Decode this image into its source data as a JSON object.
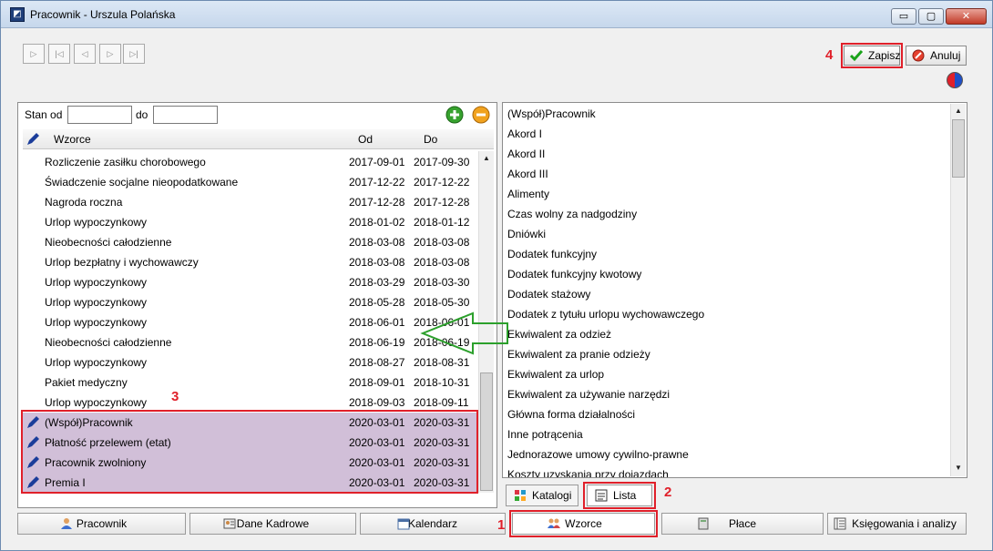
{
  "window": {
    "title": "Pracownik - Urszula Polańska",
    "min_glyph": "▭",
    "max_glyph": "▢",
    "close_glyph": "✕"
  },
  "nav_buttons": [
    "▷",
    "|◁",
    "◁",
    "▷",
    "▷|"
  ],
  "toolbar": {
    "save_label": "Zapisz",
    "cancel_label": "Anuluj"
  },
  "filter": {
    "from_label": "Stan od",
    "to_label": "do",
    "from_value": "",
    "to_value": ""
  },
  "grid": {
    "columns": [
      "Wzorce",
      "Od",
      "Do"
    ],
    "rows": [
      {
        "name": "Rozliczenie zasiłku chorobowego",
        "od": "2017-09-01",
        "do": "2017-09-30",
        "selected": false
      },
      {
        "name": "Świadczenie socjalne nieopodatkowane",
        "od": "2017-12-22",
        "do": "2017-12-22",
        "selected": false
      },
      {
        "name": "Nagroda roczna",
        "od": "2017-12-28",
        "do": "2017-12-28",
        "selected": false
      },
      {
        "name": "Urlop wypoczynkowy",
        "od": "2018-01-02",
        "do": "2018-01-12",
        "selected": false
      },
      {
        "name": "Nieobecności całodzienne",
        "od": "2018-03-08",
        "do": "2018-03-08",
        "selected": false
      },
      {
        "name": "Urlop bezpłatny i wychowawczy",
        "od": "2018-03-08",
        "do": "2018-03-08",
        "selected": false
      },
      {
        "name": "Urlop wypoczynkowy",
        "od": "2018-03-29",
        "do": "2018-03-30",
        "selected": false
      },
      {
        "name": "Urlop wypoczynkowy",
        "od": "2018-05-28",
        "do": "2018-05-30",
        "selected": false
      },
      {
        "name": "Urlop wypoczynkowy",
        "od": "2018-06-01",
        "do": "2018-06-01",
        "selected": false
      },
      {
        "name": "Nieobecności całodzienne",
        "od": "2018-06-19",
        "do": "2018-06-19",
        "selected": false
      },
      {
        "name": "Urlop wypoczynkowy",
        "od": "2018-08-27",
        "do": "2018-08-31",
        "selected": false
      },
      {
        "name": "Pakiet medyczny",
        "od": "2018-09-01",
        "do": "2018-10-31",
        "selected": false
      },
      {
        "name": "Urlop wypoczynkowy",
        "od": "2018-09-03",
        "do": "2018-09-11",
        "selected": false
      },
      {
        "name": "(Współ)Pracownik",
        "od": "2020-03-01",
        "do": "2020-03-31",
        "selected": true
      },
      {
        "name": "Płatność przelewem (etat)",
        "od": "2020-03-01",
        "do": "2020-03-31",
        "selected": true
      },
      {
        "name": "Pracownik zwolniony",
        "od": "2020-03-01",
        "do": "2020-03-31",
        "selected": true
      },
      {
        "name": "Premia I",
        "od": "2020-03-01",
        "do": "2020-03-31",
        "selected": true
      }
    ]
  },
  "list": {
    "items": [
      "(Współ)Pracownik",
      "Akord I",
      "Akord II",
      "Akord III",
      "Alimenty",
      "Czas wolny za nadgodziny",
      "Dniówki",
      "Dodatek funkcyjny",
      "Dodatek funkcyjny kwotowy",
      "Dodatek stażowy",
      "Dodatek z tytułu urlopu wychowawczego",
      "Ekwiwalent za odzież",
      "Ekwiwalent za pranie odzieży",
      "Ekwiwalent za urlop",
      "Ekwiwalent za używanie narzędzi",
      "Główna forma działalności",
      "Inne potrącenia",
      "Jednorazowe umowy cywilno-prawne",
      "Koszty uzyskania przy dojazdach"
    ]
  },
  "subtabs": {
    "katalogi": "Katalogi",
    "lista": "Lista"
  },
  "bottom_tabs": [
    "Pracownik",
    "Dane Kadrowe",
    "Kalendarz",
    "Wzorce",
    "Płace",
    "Księgowania i analizy"
  ],
  "callouts": [
    "1",
    "2",
    "3",
    "4"
  ],
  "colors": {
    "highlight": "#e0202a",
    "selected_row": "#d1bfd8",
    "arrow": "#2ca02c"
  }
}
